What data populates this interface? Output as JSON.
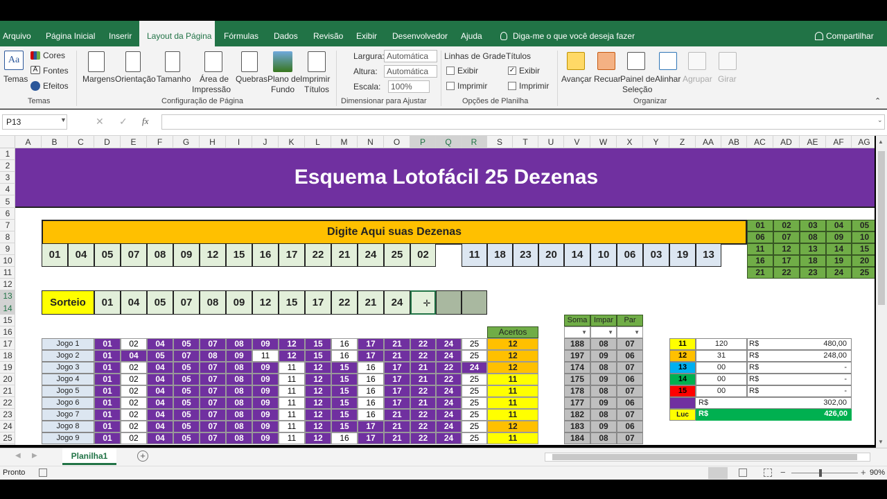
{
  "menu": {
    "tabs": [
      "Arquivo",
      "Página Inicial",
      "Inserir",
      "Layout da Página",
      "Fórmulas",
      "Dados",
      "Revisão",
      "Exibir",
      "Desenvolvedor",
      "Ajuda"
    ],
    "active": "Layout da Página",
    "tell_me": "Diga-me o que você deseja fazer",
    "share": "Compartilhar"
  },
  "ribbon": {
    "temas": {
      "temas": "Temas",
      "cores": "Cores",
      "fontes": "Fontes",
      "efeitos": "Efeitos",
      "group": "Temas"
    },
    "config": {
      "margens": "Margens",
      "orientacao": "Orientação",
      "tamanho": "Tamanho",
      "area1": "Área de",
      "area2": "Impressão",
      "quebras": "Quebras",
      "plano1": "Plano de",
      "plano2": "Fundo",
      "imprimir1": "Imprimir",
      "imprimir2": "Títulos",
      "group": "Configuração de Página"
    },
    "dimensionar": {
      "largura": "Largura:",
      "largura_val": "Automática",
      "altura": "Altura:",
      "altura_val": "Automática",
      "escala": "Escala:",
      "escala_val": "100%",
      "group": "Dimensionar para Ajustar"
    },
    "opcoes": {
      "linhas": "Linhas de Grade",
      "titulos": "Títulos",
      "exibir": "Exibir",
      "imprimir": "Imprimir",
      "group": "Opções de Planilha"
    },
    "organizar": {
      "avancar": "Avançar",
      "recuar": "Recuar",
      "painel1": "Painel de",
      "painel2": "Seleção",
      "alinhar": "Alinhar",
      "agrupar": "Agrupar",
      "girar": "Girar",
      "group": "Organizar"
    }
  },
  "formula_bar": {
    "name_box": "P13",
    "fx": "fx",
    "formula": ""
  },
  "columns": [
    "A",
    "B",
    "C",
    "D",
    "E",
    "F",
    "G",
    "H",
    "I",
    "J",
    "K",
    "L",
    "M",
    "N",
    "O",
    "P",
    "Q",
    "R",
    "S",
    "T",
    "U",
    "V",
    "W",
    "X",
    "Y",
    "Z",
    "AA",
    "AB",
    "AC",
    "AD",
    "AE",
    "AF",
    "AG"
  ],
  "rows": [
    "1",
    "2",
    "3",
    "4",
    "5",
    "6",
    "7",
    "8",
    "9",
    "10",
    "11",
    "12",
    "13",
    "14",
    "15",
    "16",
    "17",
    "18",
    "19",
    "20",
    "21",
    "22",
    "23",
    "24",
    "25"
  ],
  "selected_cell": {
    "column": "P",
    "row": "13"
  },
  "sheet": {
    "title": "Esquema Lotofácil 25 Dezenas",
    "input_header": "Digite Aqui suas Dezenas",
    "input_numbers_left": [
      "01",
      "04",
      "05",
      "07",
      "08",
      "09",
      "12",
      "15",
      "16",
      "17",
      "22",
      "21",
      "24",
      "25",
      "02"
    ],
    "input_numbers_right": [
      "11",
      "18",
      "23",
      "20",
      "14",
      "10",
      "06",
      "03",
      "19",
      "13"
    ],
    "sorteio_label": "Sorteio",
    "sorteio_numbers": [
      "01",
      "04",
      "05",
      "07",
      "08",
      "09",
      "12",
      "15",
      "17",
      "22",
      "21",
      "24",
      "",
      "",
      ""
    ],
    "acertos_header": "Acertos",
    "number_grid": [
      [
        "01",
        "02",
        "03",
        "04",
        "05"
      ],
      [
        "06",
        "07",
        "08",
        "09",
        "10"
      ],
      [
        "11",
        "12",
        "13",
        "14",
        "15"
      ],
      [
        "16",
        "17",
        "18",
        "19",
        "20"
      ],
      [
        "21",
        "22",
        "23",
        "24",
        "25"
      ]
    ],
    "stats_headers": [
      "Soma",
      "Impar",
      "Par"
    ],
    "jogos": [
      {
        "label": "Jogo 1",
        "nums": [
          "01",
          "02",
          "04",
          "05",
          "07",
          "08",
          "09",
          "12",
          "15",
          "16",
          "17",
          "21",
          "22",
          "24",
          "25"
        ],
        "acertos": "12",
        "soma": "188",
        "impar": "08",
        "par": "07"
      },
      {
        "label": "Jogo 2",
        "nums": [
          "01",
          "04",
          "05",
          "07",
          "08",
          "09",
          "11",
          "12",
          "15",
          "16",
          "17",
          "21",
          "22",
          "24",
          "25"
        ],
        "acertos": "12",
        "soma": "197",
        "impar": "09",
        "par": "06"
      },
      {
        "label": "Jogo 3",
        "nums": [
          "01",
          "02",
          "04",
          "05",
          "07",
          "08",
          "09",
          "11",
          "12",
          "15",
          "16",
          "17",
          "21",
          "22",
          "24"
        ],
        "acertos": "12",
        "soma": "174",
        "impar": "08",
        "par": "07"
      },
      {
        "label": "Jogo 4",
        "nums": [
          "01",
          "02",
          "04",
          "05",
          "07",
          "08",
          "09",
          "11",
          "12",
          "15",
          "16",
          "17",
          "21",
          "22",
          "25"
        ],
        "acertos": "11",
        "soma": "175",
        "impar": "09",
        "par": "06"
      },
      {
        "label": "Jogo 5",
        "nums": [
          "01",
          "02",
          "04",
          "05",
          "07",
          "08",
          "09",
          "11",
          "12",
          "15",
          "16",
          "17",
          "22",
          "24",
          "25"
        ],
        "acertos": "11",
        "soma": "178",
        "impar": "08",
        "par": "07"
      },
      {
        "label": "Jogo 6",
        "nums": [
          "01",
          "02",
          "04",
          "05",
          "07",
          "08",
          "09",
          "11",
          "12",
          "15",
          "16",
          "17",
          "21",
          "24",
          "25"
        ],
        "acertos": "11",
        "soma": "177",
        "impar": "09",
        "par": "06"
      },
      {
        "label": "Jogo 7",
        "nums": [
          "01",
          "02",
          "04",
          "05",
          "07",
          "08",
          "09",
          "11",
          "12",
          "15",
          "16",
          "21",
          "22",
          "24",
          "25"
        ],
        "acertos": "11",
        "soma": "182",
        "impar": "08",
        "par": "07"
      },
      {
        "label": "Jogo 8",
        "nums": [
          "01",
          "02",
          "04",
          "05",
          "07",
          "08",
          "09",
          "11",
          "12",
          "15",
          "17",
          "21",
          "22",
          "24",
          "25"
        ],
        "acertos": "12",
        "soma": "183",
        "impar": "09",
        "par": "06"
      },
      {
        "label": "Jogo 9",
        "nums": [
          "01",
          "02",
          "04",
          "05",
          "07",
          "08",
          "09",
          "11",
          "12",
          "16",
          "17",
          "21",
          "22",
          "24",
          "25"
        ],
        "acertos": "11",
        "soma": "184",
        "impar": "08",
        "par": "07"
      }
    ],
    "prizes": [
      {
        "hits": "11",
        "count": "120",
        "currency": "R$",
        "value": "480,00",
        "color": "#ffff00"
      },
      {
        "hits": "12",
        "count": "31",
        "currency": "R$",
        "value": "248,00",
        "color": "#ffc000"
      },
      {
        "hits": "13",
        "count": "00",
        "currency": "R$",
        "value": "-",
        "color": "#00b0f0"
      },
      {
        "hits": "14",
        "count": "00",
        "currency": "R$",
        "value": "-",
        "color": "#00b050"
      },
      {
        "hits": "15",
        "count": "00",
        "currency": "R$",
        "value": "-",
        "color": "#ff0000"
      }
    ],
    "total": {
      "currency": "R$",
      "value": "302,00"
    },
    "lucro": {
      "label": "Luc",
      "currency": "R$",
      "value": "426,00"
    }
  },
  "sheet_tabs": {
    "active": "Planilha1"
  },
  "status": {
    "text": "Pronto",
    "zoom": "90%"
  },
  "colors": {
    "excel_green": "#217346",
    "purple": "#7030a0",
    "orange": "#ffc000",
    "yellow": "#ffff00",
    "light_green": "#e2efda",
    "light_blue": "#dce6f1",
    "grid_green": "#70ad47",
    "gray": "#bfbfbf"
  }
}
